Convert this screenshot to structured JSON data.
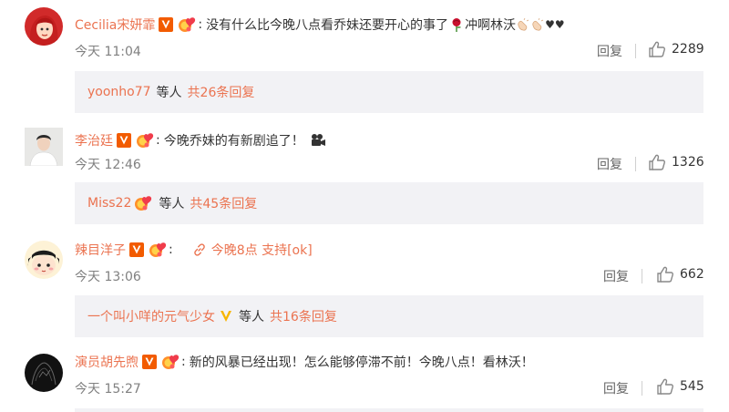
{
  "comments": [
    {
      "username": "Cecilia宋妍霏",
      "text": "没有什么比今晚八点看乔妹还要开心的事了",
      "text_suffix": "冲啊林沃",
      "hearts": "♥♥",
      "time": "今天 11:04",
      "reply_label": "回复",
      "likes": "2289",
      "sub_user": "yoonho77",
      "sub_deng": "等人",
      "sub_count": "共26条回复"
    },
    {
      "username": "李治廷",
      "text": "今晚乔妹的有新剧追了！",
      "time": "今天 12:46",
      "reply_label": "回复",
      "likes": "1326",
      "sub_user": "Miss22",
      "sub_deng": "等人",
      "sub_count": "共45条回复"
    },
    {
      "username": "辣目洋子",
      "link_text": "今晚8点 支持[ok]",
      "time": "今天 13:06",
      "reply_label": "回复",
      "likes": "662",
      "sub_user": "一个叫小咩的元气少女",
      "sub_deng": "等人",
      "sub_count": "共16条回复"
    },
    {
      "username": "演员胡先煦",
      "text": "新的风暴已经出现！怎么能够停滞不前！今晚八点！看林沃！",
      "time": "今天 15:27",
      "reply_label": "回复",
      "likes": "545"
    }
  ],
  "colors": {
    "accent": "#eb7350",
    "subbox_bg": "#f2f2f5",
    "vip_badge": "#ff8200"
  },
  "icons": [
    "v-badge-icon",
    "medal-icon",
    "rose-icon",
    "clap-icon",
    "camera-icon",
    "link-icon",
    "thumb-up-icon"
  ]
}
